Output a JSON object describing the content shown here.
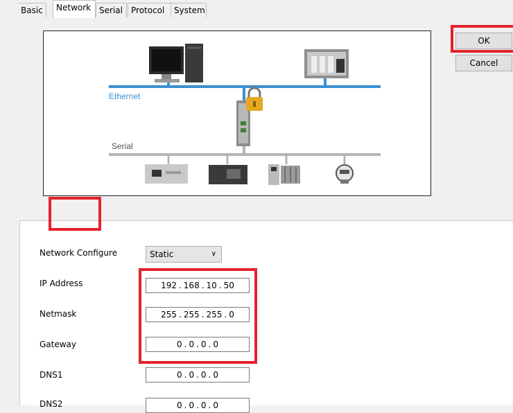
{
  "diagram": {
    "ethernet_label": "Ethernet",
    "serial_label": "Serial",
    "colors": {
      "ethernet_line": "#3b8fd0",
      "serial_line": "#b5b5b5"
    }
  },
  "buttons": {
    "ok": "OK",
    "cancel": "Cancel"
  },
  "tabs": [
    "Basic",
    "Network",
    "Serial",
    "Protocol",
    "System"
  ],
  "active_tab": "Network",
  "network": {
    "network_configure_label": "Network Configure",
    "network_configure_value": "Static",
    "fields": [
      {
        "label": "IP Address",
        "octets": [
          "192",
          "168",
          "10",
          "50"
        ]
      },
      {
        "label": "Netmask",
        "octets": [
          "255",
          "255",
          "255",
          "0"
        ]
      },
      {
        "label": "Gateway",
        "octets": [
          "0",
          "0",
          "0",
          "0"
        ]
      },
      {
        "label": "DNS1",
        "octets": [
          "0",
          "0",
          "0",
          "0"
        ]
      },
      {
        "label": "DNS2",
        "octets": [
          "0",
          "0",
          "0",
          "0"
        ]
      }
    ]
  },
  "highlight_color": "#e3222b"
}
